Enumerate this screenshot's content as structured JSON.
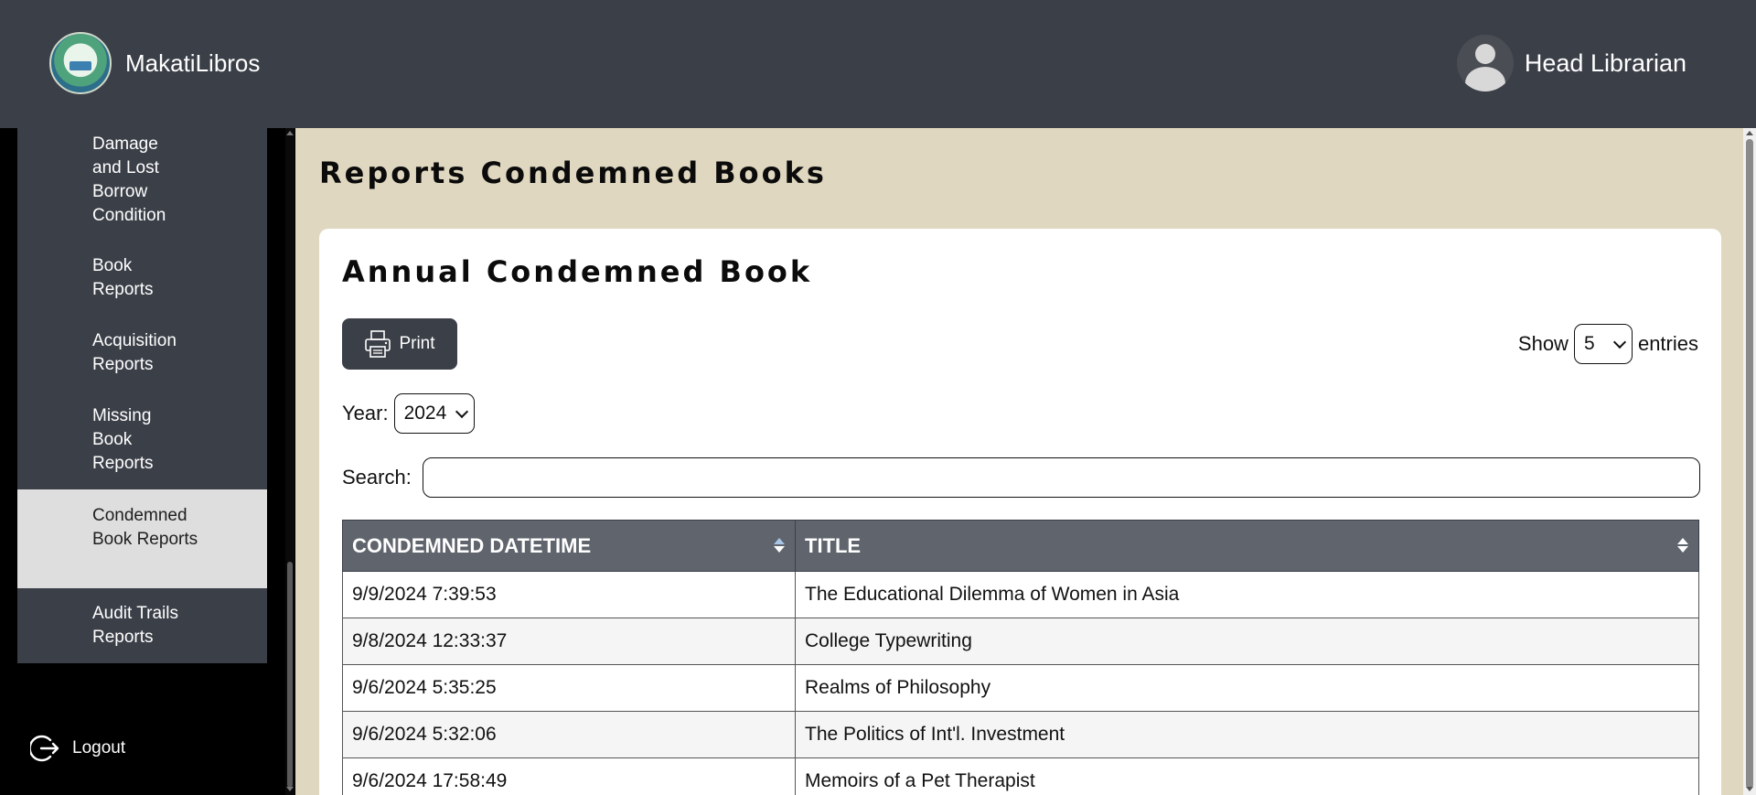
{
  "app": {
    "name": "MakatiLibros",
    "user_role": "Head Librarian"
  },
  "sidebar": {
    "items": [
      {
        "label": "Damage and Lost Borrow Condition",
        "active": false
      },
      {
        "label": "Book Reports",
        "active": false
      },
      {
        "label": "Acquisition Reports",
        "active": false
      },
      {
        "label": "Missing Book Reports",
        "active": false
      },
      {
        "label": "Condemned Book Reports",
        "active": true
      },
      {
        "label": "Audit Trails Reports",
        "active": false
      }
    ],
    "logout_label": "Logout"
  },
  "page": {
    "title": "Reports Condemned Books"
  },
  "card": {
    "title": "Annual Condemned Book",
    "print_label": "Print",
    "show_label": "Show",
    "entries_value": "5",
    "entries_label": "entries",
    "year_label": "Year:",
    "year_value": "2024",
    "search_label": "Search:",
    "search_value": ""
  },
  "table": {
    "columns": [
      "CONDEMNED DATETIME",
      "TITLE"
    ],
    "rows": [
      [
        "9/9/2024 7:39:53",
        "The Educational Dilemma of Women in Asia"
      ],
      [
        "9/8/2024 12:33:37",
        "College Typewriting"
      ],
      [
        "9/6/2024 5:35:25",
        "Realms of Philosophy"
      ],
      [
        "9/6/2024 5:32:06",
        "The Politics of Int'l. Investment"
      ],
      [
        "9/6/2024 17:58:49",
        "Memoirs of a Pet Therapist"
      ]
    ]
  },
  "colors": {
    "topbar": "#3b3f48",
    "content_bg": "#dfd7bf",
    "table_header": "#5f646d",
    "active_item": "#dedede"
  }
}
